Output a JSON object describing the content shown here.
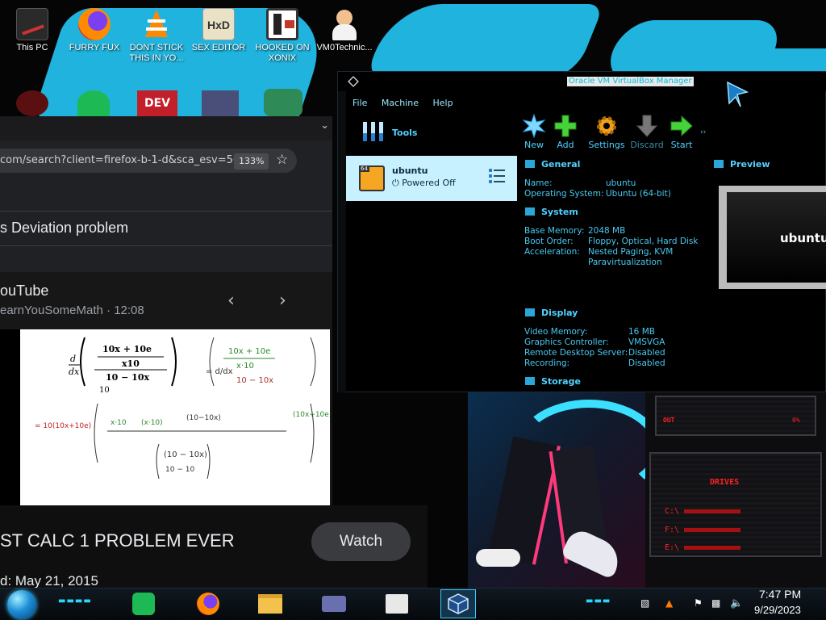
{
  "desktop": {
    "icons": [
      {
        "label": "This PC"
      },
      {
        "label": "FURRY FUX"
      },
      {
        "label": "DONT STICK THIS IN YO..."
      },
      {
        "label": "SEX EDITOR"
      },
      {
        "label": "HOOKED ON XONIX"
      },
      {
        "label": "VM0Technic..."
      }
    ],
    "dev_label": "DEV",
    "hud": {
      "out_label": "OUT",
      "drives_label": "DRIVES",
      "drives": [
        "C:\\",
        "F:\\",
        "E:\\"
      ]
    }
  },
  "browser": {
    "url": "com/search?client=firefox-b-1-d&sca_esv=56",
    "zoom": "133%",
    "query_title": "s Deviation problem",
    "source": "ouTube",
    "channel": "earnYouSomeMath · 12:08",
    "video_title": "ST CALC 1 PROBLEM EVER",
    "video_date": "d: May 21, 2015",
    "watch_label": "Watch"
  },
  "vbox": {
    "title": "Oracle VM VirtualBox Manager",
    "menu": [
      "File",
      "Machine",
      "Help"
    ],
    "tools_label": "Tools",
    "toolbar": [
      {
        "label": "New",
        "icon": "new-icon"
      },
      {
        "label": "Add",
        "icon": "add-icon"
      },
      {
        "label": "Settings",
        "icon": "settings-icon"
      },
      {
        "label": "Discard",
        "icon": "discard-icon"
      },
      {
        "label": "Start",
        "icon": "start-icon"
      }
    ],
    "vm": {
      "name": "ubuntu",
      "state": "Powered Off",
      "badge": "64"
    },
    "general": {
      "title": "General",
      "name_label": "Name:",
      "name_value": "ubuntu",
      "os_label": "Operating System:",
      "os_value": "Ubuntu (64-bit)"
    },
    "system": {
      "title": "System",
      "mem_label": "Base Memory:",
      "mem_value": "2048 MB",
      "boot_label": "Boot Order:",
      "boot_value": "Floppy, Optical, Hard Disk",
      "accel_label": "Acceleration:",
      "accel_value": "Nested Paging, KVM",
      "accel_value2": "Paravirtualization"
    },
    "preview": {
      "title": "Preview",
      "text": "ubuntu"
    },
    "display": {
      "title": "Display",
      "vmem_label": "Video Memory:",
      "vmem_value": "16 MB",
      "gc_label": "Graphics Controller:",
      "gc_value": "VMSVGA",
      "rds_label": "Remote Desktop Server:",
      "rds_value": "Disabled",
      "rec_label": "Recording:",
      "rec_value": "Disabled"
    },
    "storage": {
      "title": "Storage"
    }
  },
  "taskbar": {
    "time": "7:47 PM",
    "date": "9/29/2023"
  },
  "colors": {
    "accent": "#4fd2ff",
    "wallpaper_blue": "#1fb3dd",
    "hud_red": "#ff2020"
  }
}
